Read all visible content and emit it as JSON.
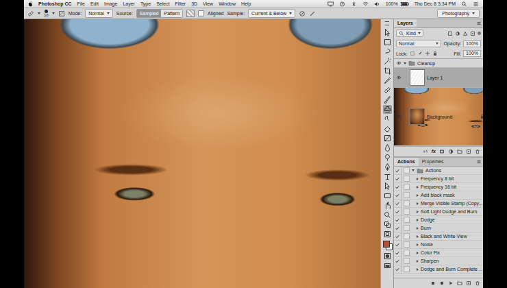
{
  "menu_bar": {
    "app": "Photoshop CC",
    "items": [
      "File",
      "Edit",
      "Image",
      "Layer",
      "Type",
      "Select",
      "Filter",
      "3D",
      "View",
      "Window",
      "Help"
    ],
    "battery": "100%",
    "clock": "Thu Dec 8 3:34 PM"
  },
  "options_bar": {
    "brush_size": "10",
    "mode_label": "Mode:",
    "mode": "Normal",
    "source_label": "Source:",
    "sources": [
      {
        "label": "Sampled",
        "selected": true
      },
      {
        "label": "Pattern",
        "selected": false
      }
    ],
    "aligned": {
      "label": "Aligned",
      "checked": false
    },
    "sample_label": "Sample:",
    "sample": "Current & Below",
    "workspace": "Photography"
  },
  "tools": [
    {
      "selected": false
    },
    {
      "selected": false
    },
    {
      "selected": false
    },
    {
      "selected": false
    },
    {
      "selected": false
    },
    {
      "selected": false
    },
    {
      "selected": false
    },
    {
      "selected": false
    },
    {
      "selected": true
    },
    {
      "selected": false
    },
    {
      "selected": false
    },
    {
      "selected": false
    },
    {
      "selected": false
    },
    {
      "selected": false
    },
    {
      "selected": false
    },
    {
      "selected": false
    },
    {
      "selected": false
    },
    {
      "selected": false
    },
    {
      "selected": false
    },
    {
      "selected": false
    },
    {
      "selected": false
    },
    {
      "selected": false
    }
  ],
  "layers_panel": {
    "tabs": [
      {
        "label": "Layers",
        "selected": true
      }
    ],
    "filter": "Kind",
    "blend_mode": "Normal",
    "opacity_label": "Opacity:",
    "opacity": "100%",
    "lock_label": "Lock:",
    "fill_label": "Fill:",
    "fill": "100%",
    "layers": [
      {
        "name": "Cleanup",
        "kind": "group",
        "visible": true,
        "expanded": true,
        "locked": false,
        "selected": false
      },
      {
        "name": "Layer 1",
        "kind": "layer",
        "visible": true,
        "expanded": false,
        "locked": false,
        "selected": true
      },
      {
        "name": "Background",
        "kind": "photo",
        "visible": true,
        "expanded": false,
        "locked": true,
        "selected": false
      }
    ],
    "footer_fx": "fx"
  },
  "actions_panel": {
    "tabs": [
      {
        "label": "Actions",
        "selected": true
      },
      {
        "label": "Properties",
        "selected": false
      }
    ],
    "set": {
      "name": "Actions",
      "checked": true,
      "expanded": true
    },
    "actions": [
      {
        "name": "Frequency 8 bit",
        "checked": true
      },
      {
        "name": "Frequency 16 bit",
        "checked": true
      },
      {
        "name": "Add black mask",
        "checked": true
      },
      {
        "name": "Merge Visible Stamp (Copy...",
        "checked": true
      },
      {
        "name": "Soft Light Dodge and Burn",
        "checked": true
      },
      {
        "name": "Dodge",
        "checked": true
      },
      {
        "name": "Burn",
        "checked": true
      },
      {
        "name": "Black and White View",
        "checked": true
      },
      {
        "name": "Noise",
        "checked": true
      },
      {
        "name": "Color Fix",
        "checked": true
      },
      {
        "name": "Sharpen",
        "checked": true
      },
      {
        "name": "Dodge and Burn Complete ...",
        "checked": true
      }
    ]
  }
}
